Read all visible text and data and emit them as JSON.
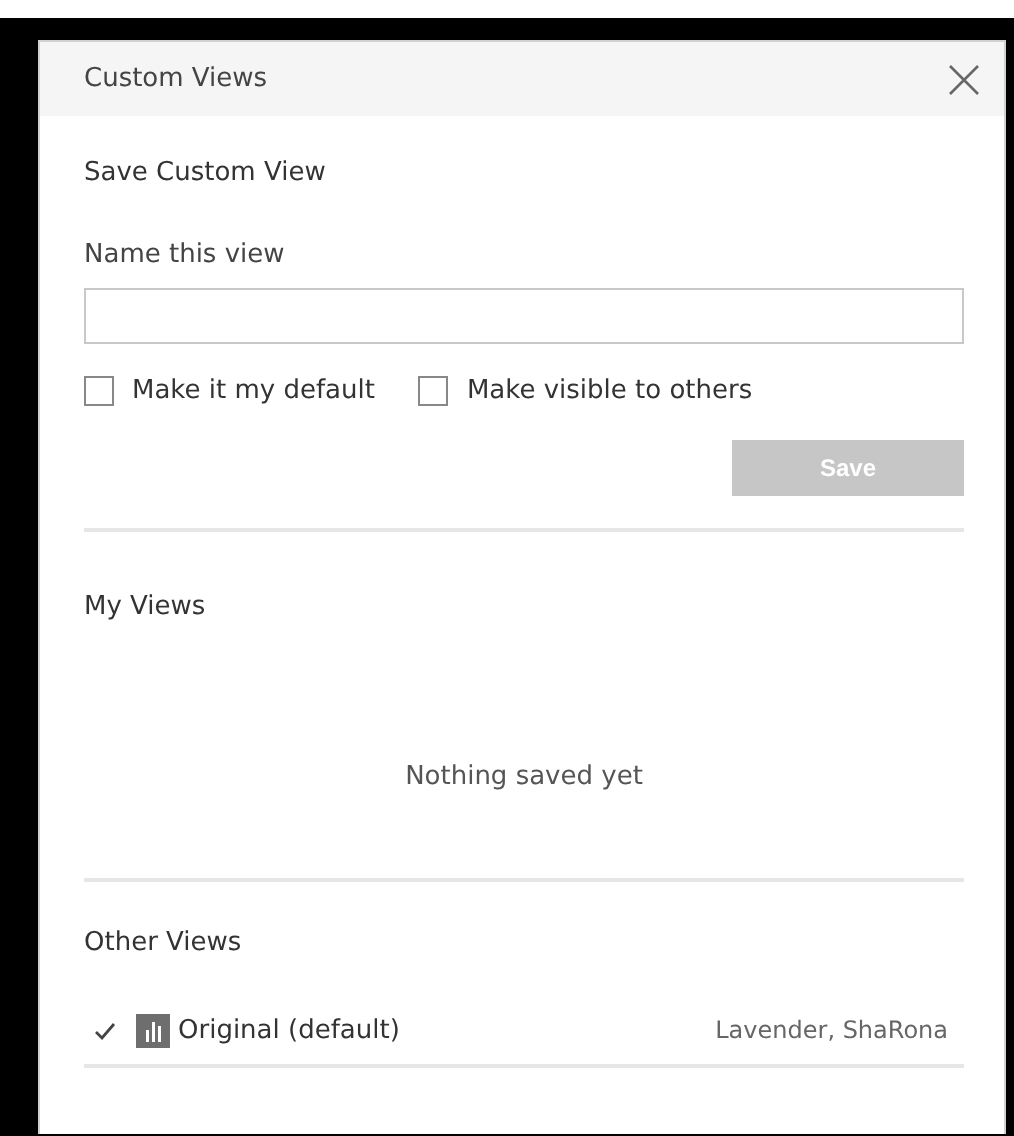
{
  "dialog": {
    "title": "Custom Views"
  },
  "save_section": {
    "heading": "Save Custom View",
    "name_label": "Name this view",
    "options": [
      {
        "label": "Make it my default",
        "checked": false
      },
      {
        "label": "Make visible to others",
        "checked": false
      }
    ],
    "save_button": {
      "label": "Save",
      "disabled": true
    }
  },
  "my_views": {
    "heading": "My Views",
    "empty_text": "Nothing saved yet"
  },
  "other_views": {
    "heading": "Other Views",
    "items": [
      {
        "name": "Original (default)",
        "owner": "Lavender, ShaRona",
        "selected": true
      }
    ]
  }
}
